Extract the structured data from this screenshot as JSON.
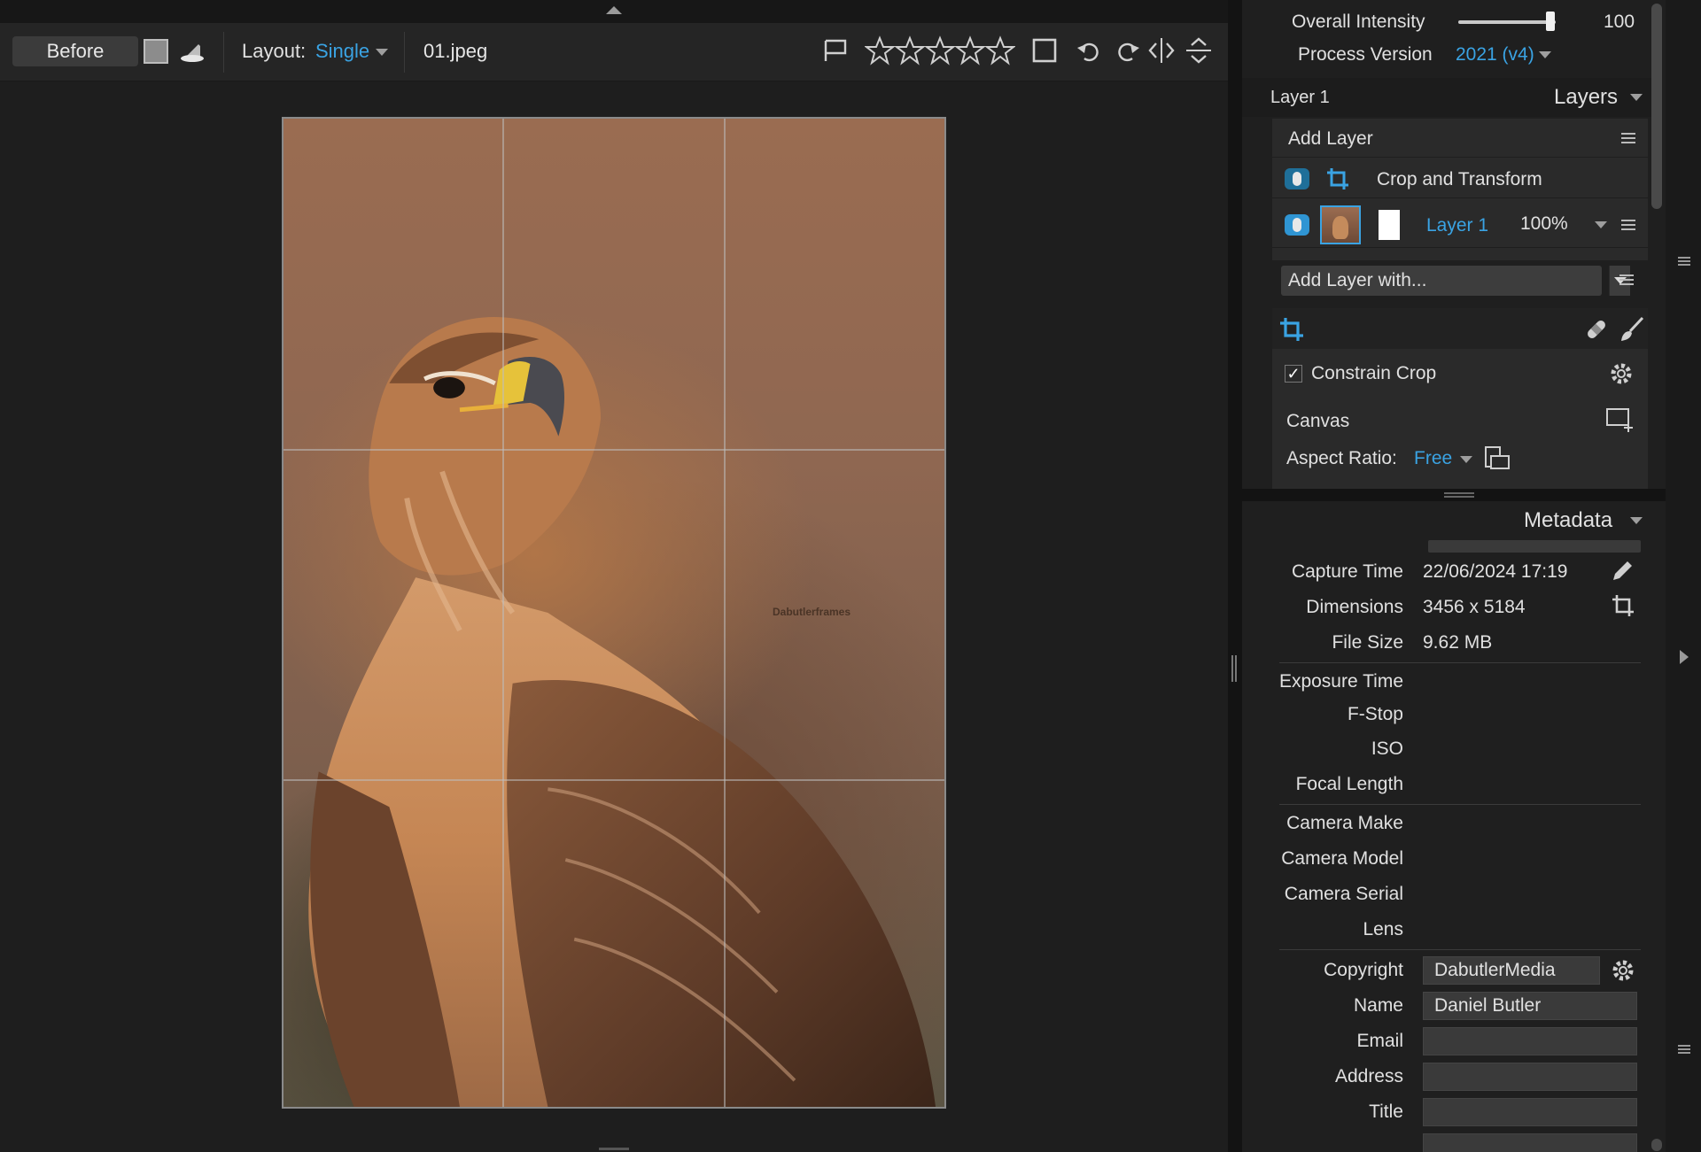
{
  "toolbar": {
    "before_label": "Before",
    "layout_label": "Layout:",
    "layout_value": "Single",
    "filename": "01.jpeg",
    "rating_stars": 0
  },
  "image": {
    "watermark": "Dabutlerframes"
  },
  "adjustments": {
    "overall_intensity_label": "Overall Intensity",
    "overall_intensity_value": "100",
    "process_version_label": "Process Version",
    "process_version_value": "2021 (v4)"
  },
  "layers": {
    "current_layer": "Layer 1",
    "panel_title": "Layers",
    "add_layer_label": "Add Layer",
    "items": [
      {
        "name": "Crop and Transform"
      },
      {
        "name": "Layer 1",
        "opacity": "100%"
      }
    ],
    "add_layer_with_label": "Add Layer with..."
  },
  "crop": {
    "constrain_label": "Constrain Crop",
    "constrain_checked": true,
    "checkbox_glyph": "✓",
    "canvas_label": "Canvas",
    "aspect_label": "Aspect Ratio:",
    "aspect_value": "Free"
  },
  "metadata": {
    "panel_title": "Metadata",
    "capture_time_label": "Capture Time",
    "capture_time_value": "22/06/2024 17:19",
    "dimensions_label": "Dimensions",
    "dimensions_value": "3456 x 5184",
    "file_size_label": "File Size",
    "file_size_value": "9.62 MB",
    "exposure_label": "Exposure Time",
    "fstop_label": "F-Stop",
    "iso_label": "ISO",
    "focal_label": "Focal Length",
    "camera_make_label": "Camera Make",
    "camera_model_label": "Camera Model",
    "camera_serial_label": "Camera Serial",
    "lens_label": "Lens",
    "copyright_label": "Copyright",
    "copyright_value": "DabutlerMedia",
    "name_label": "Name",
    "name_value": "Daniel Butler",
    "email_label": "Email",
    "email_value": "",
    "address_label": "Address",
    "address_value": "",
    "title_label": "Title",
    "title_value": ""
  },
  "colors": {
    "accent": "#3aa3e3",
    "panel_bg": "#1f1f1f",
    "viewer_bg": "#1e1e1e"
  }
}
